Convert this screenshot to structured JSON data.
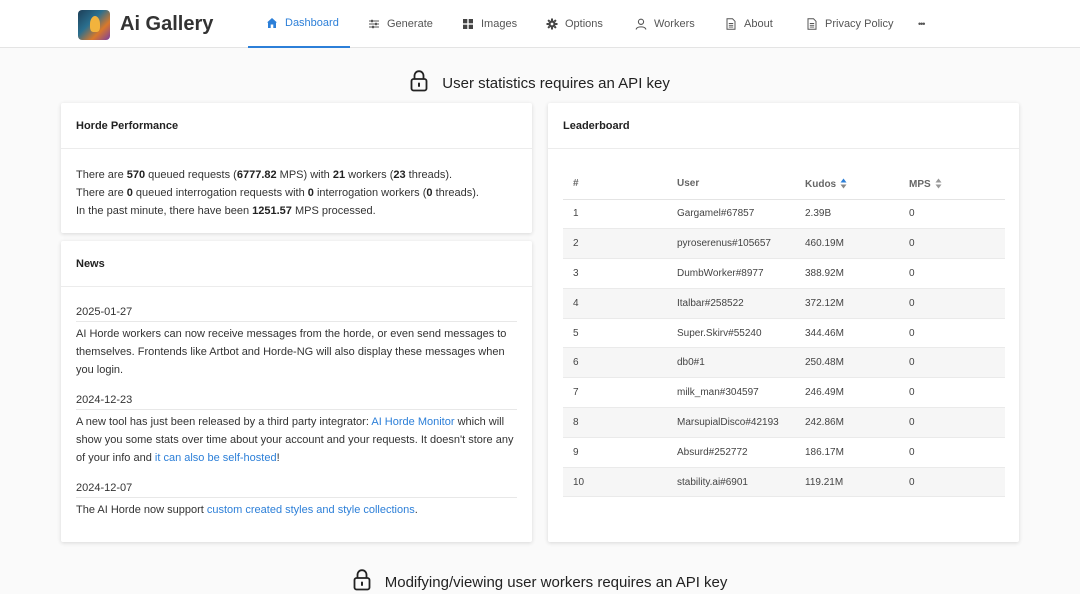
{
  "app": {
    "name": "Ai Gallery"
  },
  "nav": [
    {
      "label": "Dashboard",
      "icon": "home-icon",
      "active": true
    },
    {
      "label": "Generate",
      "icon": "sliders-icon"
    },
    {
      "label": "Images",
      "icon": "grid-icon"
    },
    {
      "label": "Options",
      "icon": "gear-icon"
    },
    {
      "label": "Workers",
      "icon": "user-icon"
    },
    {
      "label": "About",
      "icon": "document-icon"
    },
    {
      "label": "Privacy Policy",
      "icon": "document-icon"
    },
    {
      "label": "•••",
      "icon": "more-icon"
    }
  ],
  "notices": {
    "user_stats": "User statistics requires an API key",
    "user_workers": "Modifying/viewing user workers requires an API key"
  },
  "performance": {
    "title": "Horde Performance",
    "line1": {
      "a": "There are ",
      "queued": "570",
      "b": " queued requests (",
      "mps": "6777.82",
      "c": " MPS) with ",
      "workers": "21",
      "d": " workers (",
      "threads": "23",
      "e": " threads)."
    },
    "line2": {
      "a": "There are ",
      "queued": "0",
      "b": " queued interrogation requests with ",
      "workers": "0",
      "c": " interrogation workers (",
      "threads": "0",
      "d": " threads)."
    },
    "line3": {
      "a": "In the past minute, there have been ",
      "mps": "1251.57",
      "b": " MPS processed."
    }
  },
  "news": {
    "title": "News",
    "items": [
      {
        "date": "2025-01-27",
        "text": "AI Horde workers can now receive messages from the horde, or even send messages to themselves. Frontends like Artbot and Horde-NG will also display these messages when you login."
      },
      {
        "date": "2024-12-23",
        "pre": "A new tool has just been released by a third party integrator: ",
        "link1": "AI Horde Monitor",
        "mid": " which will show you some stats over time about your account and your requests. It doesn't store any of your info and ",
        "link2": "it can also be self-hosted",
        "post": "!"
      },
      {
        "date": "2024-12-07",
        "pre": "The AI Horde now support ",
        "link1": "custom created styles and style collections",
        "post": "."
      }
    ]
  },
  "leaderboard": {
    "title": "Leaderboard",
    "columns": [
      "#",
      "User",
      "Kudos",
      "MPS"
    ],
    "rows": [
      {
        "rank": "1",
        "user": "Gargamel#67857",
        "kudos": "2.39B",
        "mps": "0"
      },
      {
        "rank": "2",
        "user": "pyroserenus#105657",
        "kudos": "460.19M",
        "mps": "0"
      },
      {
        "rank": "3",
        "user": "DumbWorker#8977",
        "kudos": "388.92M",
        "mps": "0"
      },
      {
        "rank": "4",
        "user": "Italbar#258522",
        "kudos": "372.12M",
        "mps": "0"
      },
      {
        "rank": "5",
        "user": "Super.Skirv#55240",
        "kudos": "344.46M",
        "mps": "0"
      },
      {
        "rank": "6",
        "user": "db0#1",
        "kudos": "250.48M",
        "mps": "0"
      },
      {
        "rank": "7",
        "user": "milk_man#304597",
        "kudos": "246.49M",
        "mps": "0"
      },
      {
        "rank": "8",
        "user": "MarsupialDisco#42193",
        "kudos": "242.86M",
        "mps": "0"
      },
      {
        "rank": "9",
        "user": "Absurd#252772",
        "kudos": "186.17M",
        "mps": "0"
      },
      {
        "rank": "10",
        "user": "stability.ai#6901",
        "kudos": "119.21M",
        "mps": "0"
      }
    ]
  },
  "colors": {
    "accent": "#2c7fd8",
    "link": "#2c7fd8"
  }
}
